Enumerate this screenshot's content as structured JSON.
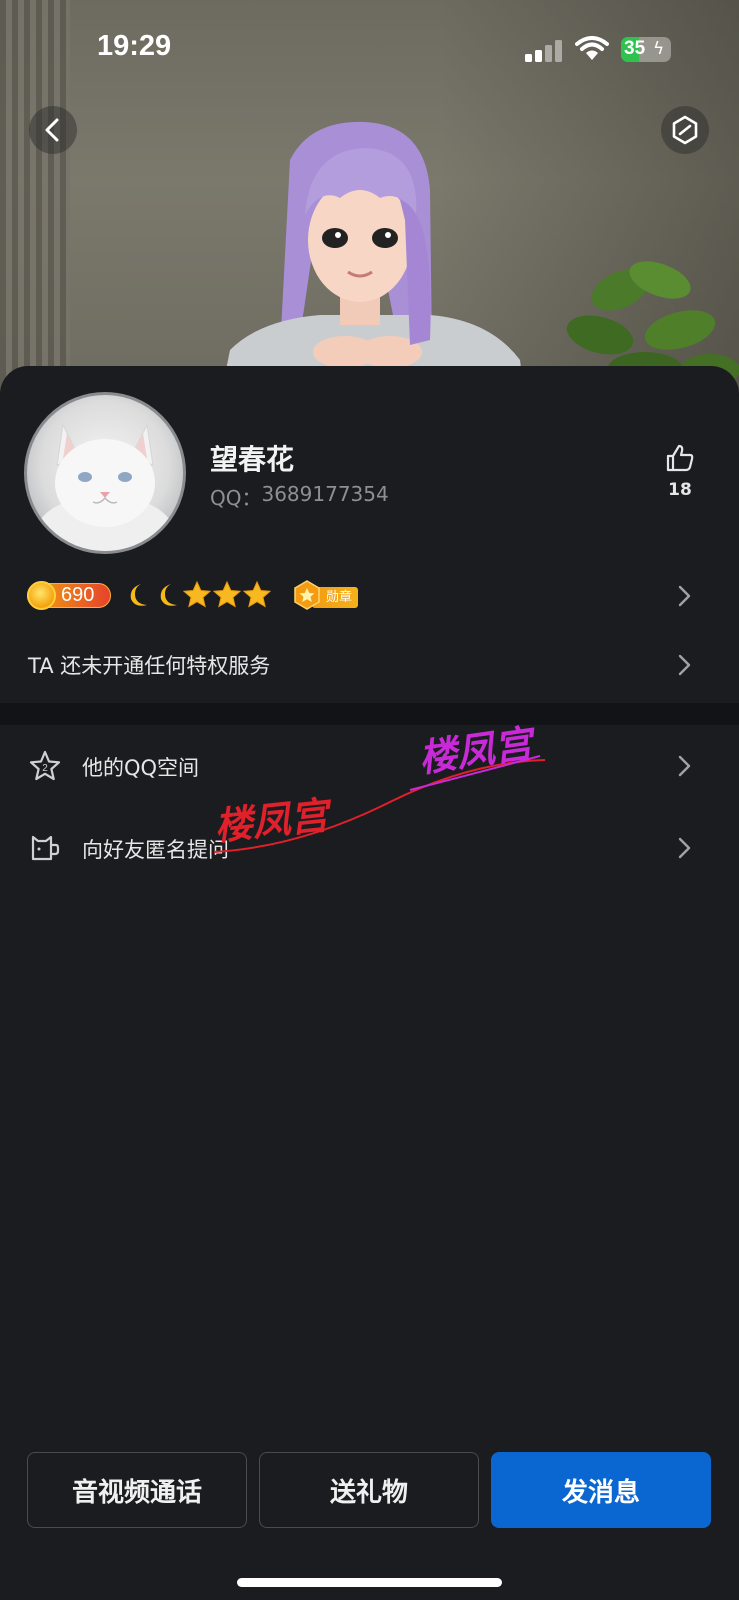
{
  "status_bar": {
    "time": "19:29",
    "battery_percent": "35"
  },
  "profile": {
    "nickname": "望春花",
    "qq_label": "QQ：",
    "qq_number": "3689177354",
    "like_count": "18"
  },
  "level": {
    "coin_value": "690",
    "medal_label": "勋章"
  },
  "privilege_text": "TA 还未开通任何特权服务",
  "menu": [
    {
      "label": "他的QQ空间",
      "icon": "star-icon"
    },
    {
      "label": "向好友匿名提问",
      "icon": "question-box-icon"
    }
  ],
  "watermark": {
    "text": "楼凤宫"
  },
  "actions": {
    "call_label": "音视频通话",
    "gift_label": "送礼物",
    "message_label": "发消息"
  },
  "colors": {
    "background": "#1b1c1f",
    "primary": "#0a66d1",
    "battery": "#30c24f"
  }
}
